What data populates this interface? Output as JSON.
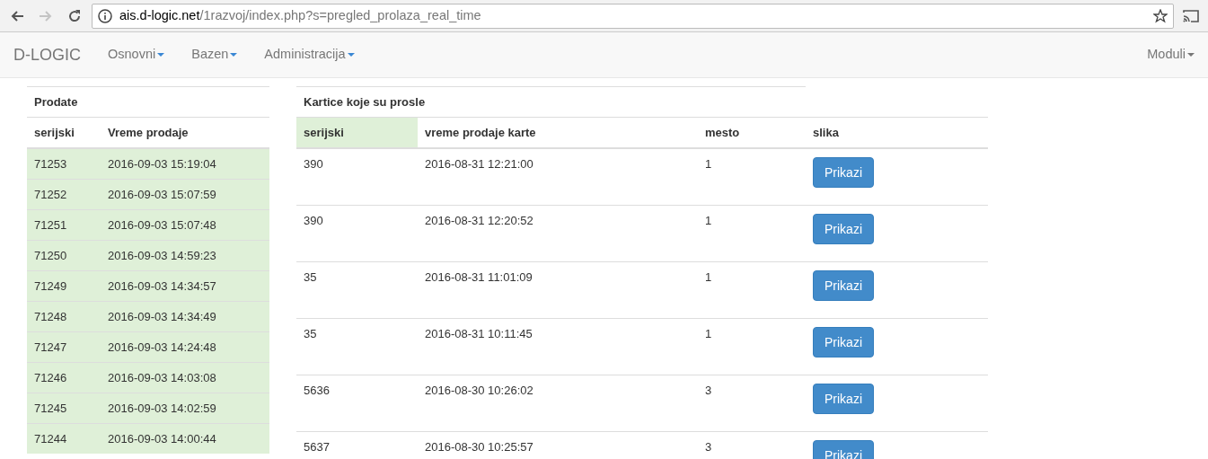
{
  "browser": {
    "url_host": "ais.d-logic.net",
    "url_path": "/1razvoj/index.php?s=pregled_prolaza_real_time",
    "forward_disabled": true
  },
  "navbar": {
    "brand": "D-LOGIC",
    "menus": [
      "Osnovni",
      "Bazen",
      "Administracija"
    ],
    "right_menus": [
      "Moduli"
    ]
  },
  "sold": {
    "title": "Prodate",
    "columns": [
      "serijski",
      "Vreme prodaje"
    ],
    "rows": [
      [
        "71253",
        "2016-09-03 15:19:04"
      ],
      [
        "71252",
        "2016-09-03 15:07:59"
      ],
      [
        "71251",
        "2016-09-03 15:07:48"
      ],
      [
        "71250",
        "2016-09-03 14:59:23"
      ],
      [
        "71249",
        "2016-09-03 14:34:57"
      ],
      [
        "71248",
        "2016-09-03 14:34:49"
      ],
      [
        "71247",
        "2016-09-03 14:24:48"
      ],
      [
        "71246",
        "2016-09-03 14:03:08"
      ],
      [
        "71245",
        "2016-09-03 14:02:59"
      ],
      [
        "71244",
        "2016-09-03 14:00:44"
      ]
    ]
  },
  "passed": {
    "title": "Kartice koje su prosle",
    "columns": [
      {
        "label": "serijski",
        "highlighted": true
      },
      {
        "label": "vreme prodaje karte",
        "highlighted": false
      },
      {
        "label": "mesto",
        "highlighted": false
      },
      {
        "label": "slika",
        "highlighted": false
      }
    ],
    "rows": [
      {
        "serial": "390",
        "time": "2016-08-31 12:21:00",
        "place": "1",
        "button": "Prikazi"
      },
      {
        "serial": "390",
        "time": "2016-08-31 12:20:52",
        "place": "1",
        "button": "Prikazi"
      },
      {
        "serial": "35",
        "time": "2016-08-31 11:01:09",
        "place": "1",
        "button": "Prikazi"
      },
      {
        "serial": "35",
        "time": "2016-08-31 10:11:45",
        "place": "1",
        "button": "Prikazi"
      },
      {
        "serial": "5636",
        "time": "2016-08-30 10:26:02",
        "place": "3",
        "button": "Prikazi"
      },
      {
        "serial": "5637",
        "time": "2016-08-30 10:25:57",
        "place": "3",
        "button": "Prikazi"
      }
    ]
  }
}
